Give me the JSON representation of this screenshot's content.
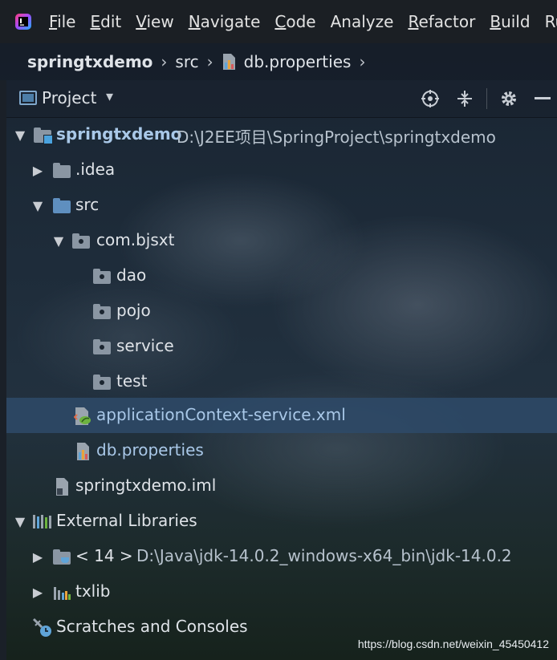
{
  "menu": {
    "items": [
      {
        "mnemonic": "F",
        "rest": "ile"
      },
      {
        "mnemonic": "E",
        "rest": "dit"
      },
      {
        "mnemonic": "V",
        "rest": "iew"
      },
      {
        "mnemonic": "N",
        "rest": "avigate"
      },
      {
        "mnemonic": "C",
        "rest": "ode"
      },
      {
        "mnemonic": "",
        "rest": "Analyze",
        "mn_after": "A"
      },
      {
        "mnemonic": "R",
        "rest": "efactor"
      },
      {
        "mnemonic": "B",
        "rest": "uild"
      },
      {
        "mnemonic": "",
        "rest": "Run"
      }
    ]
  },
  "breadcrumb": {
    "root": "springtxdemo",
    "sep": "›",
    "src": "src",
    "file": "db.properties"
  },
  "toolbar": {
    "view_label": "Project",
    "dropdown_glyph": "▾",
    "locate_glyph": "⊕",
    "collapse_glyph": "⇕",
    "settings_glyph": "⚙",
    "hide_glyph": "—"
  },
  "tree": {
    "project": {
      "name": "springtxdemo",
      "path": "D:\\J2EE项目\\SpringProject\\springtxdemo"
    },
    "idea": ".idea",
    "src": "src",
    "package": "com.bjsxt",
    "subpackages": [
      "dao",
      "pojo",
      "service",
      "test"
    ],
    "app_context": "applicationContext-service.xml",
    "db_props": "db.properties",
    "iml": "springtxdemo.iml",
    "external_libraries": "External Libraries",
    "jdk": {
      "name": "< 14 >",
      "path": "D:\\Java\\jdk-14.0.2_windows-x64_bin\\jdk-14.0.2"
    },
    "txlib": "txlib",
    "scratches": "Scratches and Consoles"
  },
  "colors": {
    "folder_blue": "#5f8fbf",
    "folder_grey": "#8a96a3",
    "selection": "#2e4a68"
  },
  "watermark": "https://blog.csdn.net/weixin_45450412"
}
